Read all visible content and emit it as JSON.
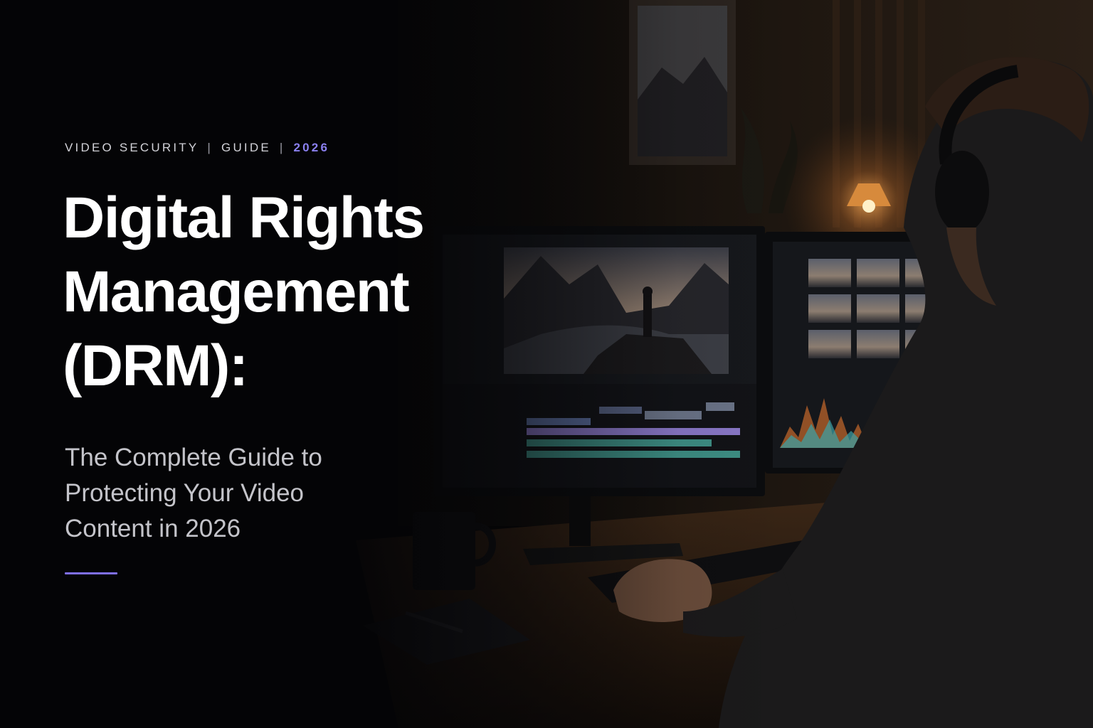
{
  "eyebrow": {
    "category": "VIDEO SECURITY",
    "separator": "|",
    "type": "GUIDE",
    "year": "2026"
  },
  "title": {
    "line1": "Digital Rights",
    "line2": "Management",
    "line3": "(DRM):"
  },
  "subtitle": {
    "line1": "The Complete Guide to",
    "line2": "Protecting Your Video",
    "line3": "Content in 2026"
  },
  "colors": {
    "background": "#050506",
    "accent": "#7f6ff0",
    "title": "#ffffff",
    "subtitle": "#c4c4ca",
    "eyebrow": "#d2d2d8"
  }
}
